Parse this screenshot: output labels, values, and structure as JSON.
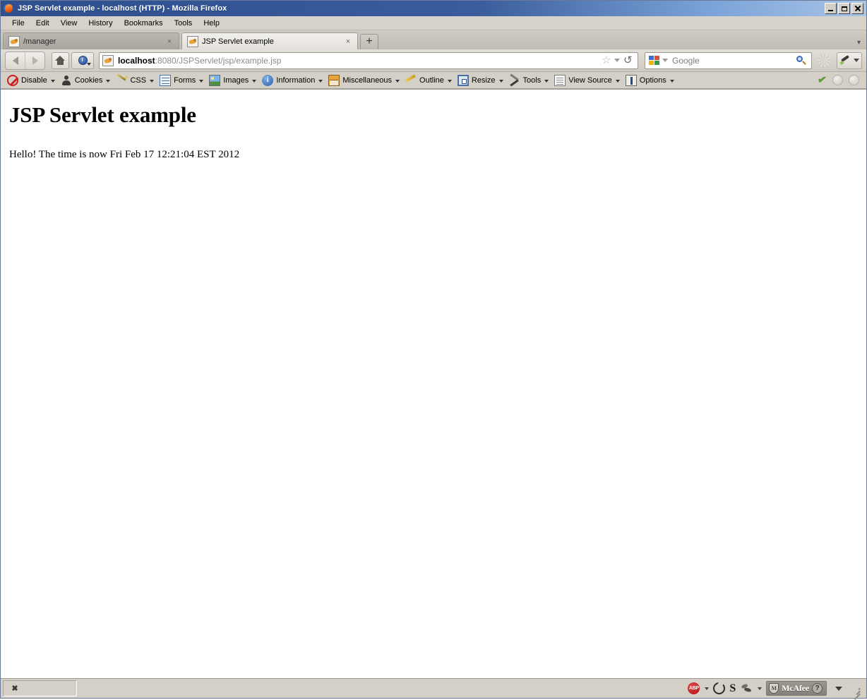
{
  "window": {
    "title": "JSP Servlet example - localhost (HTTP) - Mozilla Firefox",
    "controls": {
      "minimize": "_",
      "maximize": "□",
      "close": "×"
    }
  },
  "menubar": {
    "items": [
      {
        "label": "File"
      },
      {
        "label": "Edit"
      },
      {
        "label": "View"
      },
      {
        "label": "History"
      },
      {
        "label": "Bookmarks"
      },
      {
        "label": "Tools"
      },
      {
        "label": "Help"
      }
    ]
  },
  "tabs": {
    "list": [
      {
        "label": "/manager",
        "active": false,
        "close": "×"
      },
      {
        "label": "JSP Servlet example",
        "active": true,
        "close": "×"
      }
    ],
    "new_tab_label": "+",
    "list_all_label": "▾"
  },
  "navbar": {
    "back_label": "◄",
    "forward_label": "►",
    "home_label": "Home",
    "identity_label": "Site Identity",
    "url": {
      "host": "localhost",
      "rest": ":8080/JSPServlet/jsp/example.jsp",
      "full": "localhost:8080/JSPServlet/jsp/example.jsp"
    },
    "bookmark_star": "☆",
    "bookmark_caret": "▾",
    "reload_label": "↻",
    "search": {
      "engine": "Google",
      "placeholder": "Google",
      "value": "",
      "go_label": "Search"
    },
    "colorpicker_label": "ColorZilla",
    "colorpicker_caret": "▾"
  },
  "devtoolbar": {
    "items": [
      {
        "label": "Disable",
        "icon": "disable-icon",
        "caret": "▾"
      },
      {
        "label": "Cookies",
        "icon": "cookies-icon",
        "caret": "▾"
      },
      {
        "label": "CSS",
        "icon": "css-icon",
        "caret": "▾"
      },
      {
        "label": "Forms",
        "icon": "forms-icon",
        "caret": "▾"
      },
      {
        "label": "Images",
        "icon": "images-icon",
        "caret": "▾"
      },
      {
        "label": "Information",
        "icon": "information-icon",
        "caret": "▾"
      },
      {
        "label": "Miscellaneous",
        "icon": "miscellaneous-icon",
        "caret": "▾"
      },
      {
        "label": "Outline",
        "icon": "outline-icon",
        "caret": "▾"
      },
      {
        "label": "Resize",
        "icon": "resize-icon",
        "caret": "▾"
      },
      {
        "label": "Tools",
        "icon": "tools-icon",
        "caret": "▾"
      },
      {
        "label": "View Source",
        "icon": "view-source-icon",
        "caret": "▾"
      },
      {
        "label": "Options",
        "icon": "options-icon",
        "caret": "▾"
      }
    ],
    "validate_label": "✔"
  },
  "page": {
    "heading": "JSP Servlet example",
    "paragraph": "Hello! The time is now Fri Feb 17 12:21:04 EST 2012"
  },
  "statusbar": {
    "close_label": "✖",
    "abp_label": "ABP",
    "abp_caret": "▾",
    "sync_label": "Sync",
    "skype_label": "S",
    "fly_label": "FlashGot",
    "fly_caret": "▾",
    "mcafee_label": "McAfee",
    "mcafee_help": "?",
    "overflow_caret": "▾"
  },
  "colors": {
    "titlebar_start": "#2f4f8f",
    "titlebar_end": "#a8c4e6",
    "chrome": "#d4d0c8",
    "content_bg": "#ffffff",
    "accent_green": "#5f9b35",
    "abp_red": "#b01414"
  }
}
